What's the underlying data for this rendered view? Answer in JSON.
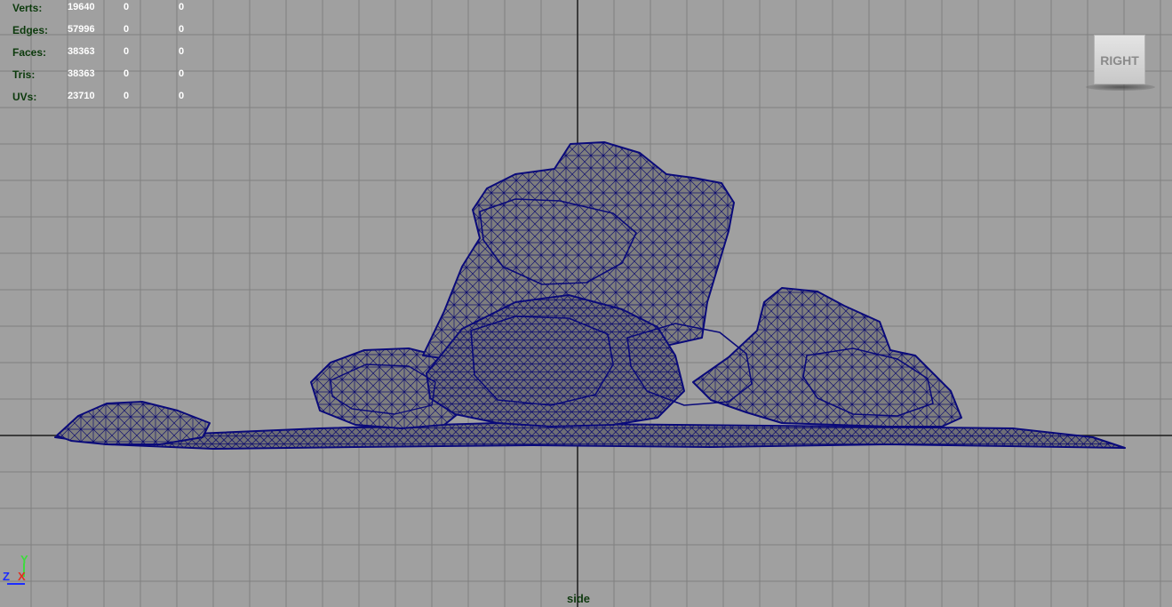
{
  "viewport": {
    "camera_name": "side",
    "background_color": "#a0a0a0",
    "grid_color": "#808080",
    "axis_line_color": "#1a1a1a",
    "wireframe_color": "#0a0a7a",
    "mesh_shading_color": "#7a7a7a"
  },
  "hud": {
    "rows": [
      {
        "label": "Verts:",
        "values": [
          "19640",
          "0",
          "0"
        ]
      },
      {
        "label": "Edges:",
        "values": [
          "57996",
          "0",
          "0"
        ]
      },
      {
        "label": "Faces:",
        "values": [
          "38363",
          "0",
          "0"
        ]
      },
      {
        "label": "Tris:",
        "values": [
          "38363",
          "0",
          "0"
        ]
      },
      {
        "label": "UVs:",
        "values": [
          "23710",
          "0",
          "0"
        ]
      }
    ]
  },
  "view_cube": {
    "label": "RIGHT"
  },
  "axis_gizmo": {
    "y": "Y",
    "z": "Z",
    "x": "X",
    "y_color": "#3cdc3c",
    "z_color": "#1c2cff",
    "x_color": "#e03020"
  }
}
